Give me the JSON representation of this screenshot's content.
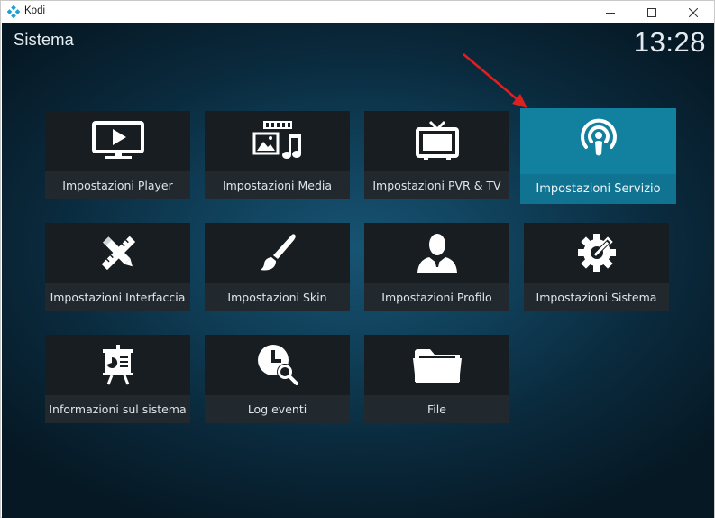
{
  "window": {
    "app_name": "Kodi"
  },
  "header": {
    "title": "Sistema",
    "clock": "13:28"
  },
  "tiles": [
    {
      "label": "Impostazioni Player",
      "icon": "tv-play-icon"
    },
    {
      "label": "Impostazioni Media",
      "icon": "media-icon"
    },
    {
      "label": "Impostazioni PVR & TV",
      "icon": "tv-antenna-icon"
    },
    {
      "label": "Impostazioni Servizio",
      "icon": "podcast-icon",
      "selected": true
    },
    {
      "label": "Impostazioni Interfaccia",
      "icon": "ruler-pencil-icon"
    },
    {
      "label": "Impostazioni Skin",
      "icon": "paintbrush-icon"
    },
    {
      "label": "Impostazioni Profilo",
      "icon": "user-profile-icon"
    },
    {
      "label": "Impostazioni Sistema",
      "icon": "gear-wrench-icon"
    },
    {
      "label": "Informazioni sul sistema",
      "icon": "presentation-board-icon"
    },
    {
      "label": "Log eventi",
      "icon": "clock-search-icon"
    },
    {
      "label": "File",
      "icon": "folder-icon"
    }
  ],
  "colors": {
    "selected": "#12819f",
    "tile": "#171d21",
    "tile_label": "#22292e",
    "annotation_arrow": "#e02020"
  }
}
